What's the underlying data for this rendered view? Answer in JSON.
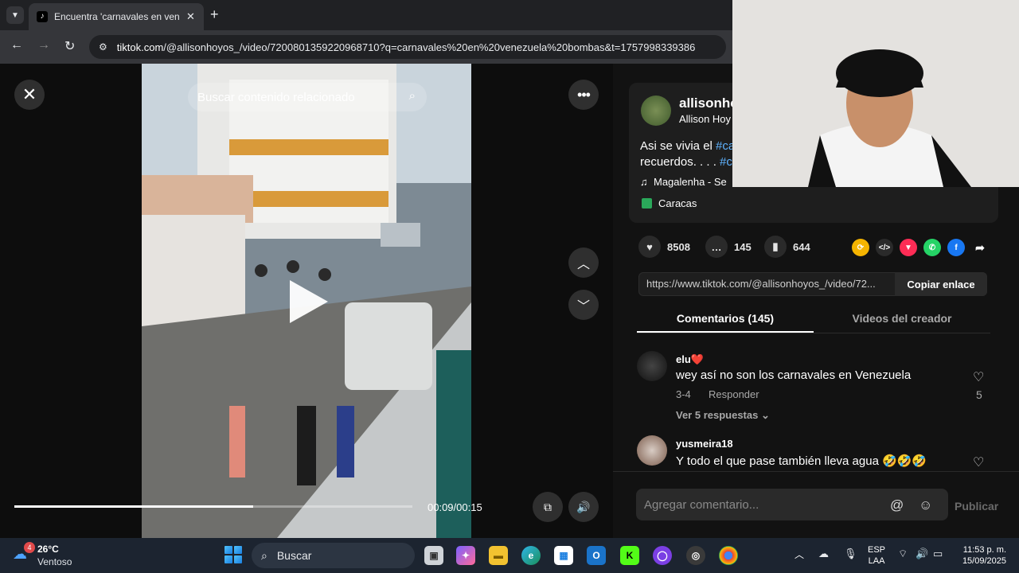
{
  "browser": {
    "tab_title": "Encuentra 'carnavales en venez",
    "tab_favicon": "tiktok-icon",
    "url_host": "tiktok.com",
    "url_path": "/@allisonhoyos_/video/7200801359220968710?q=carnavales%20en%20venezuela%20bombas&t=1757998339386"
  },
  "player": {
    "search_related": "Buscar contenido relacionado",
    "time": "00:09/00:15",
    "progress": 0.6
  },
  "post": {
    "username": "allisonho",
    "nickname": "Allison Hoy",
    "desc_line1": "Asi se vivia el ",
    "desc_tag1": "#ca",
    "desc_line2": "recuerdos. . . . ",
    "desc_tag2": "#c",
    "music": "Magalenha - Se",
    "location": "Caracas",
    "likes": "8508",
    "comments": "145",
    "saves": "644",
    "link": "https://www.tiktok.com/@allisonhoyos_/video/72...",
    "copy_label": "Copiar enlace"
  },
  "tabs": {
    "comments": "Comentarios (145)",
    "videos": "Videos del creador"
  },
  "comments": [
    {
      "user": "elu❤️",
      "text": "wey así no son los carnavales en Venezuela",
      "date": "3-4",
      "reply": "Responder",
      "likes": "5",
      "more": "Ver 5 respuestas"
    },
    {
      "user": "yusmeira18",
      "text": "Y todo el que pase también lleva agua 🤣🤣🤣"
    }
  ],
  "composer": {
    "placeholder": "Agregar comentario...",
    "publish": "Publicar"
  },
  "taskbar": {
    "badge": "4",
    "temp": "26°C",
    "weather": "Ventoso",
    "search": "Buscar",
    "lang1": "ESP",
    "lang2": "LAA",
    "time": "11:53 p. m.",
    "date": "15/09/2025"
  }
}
